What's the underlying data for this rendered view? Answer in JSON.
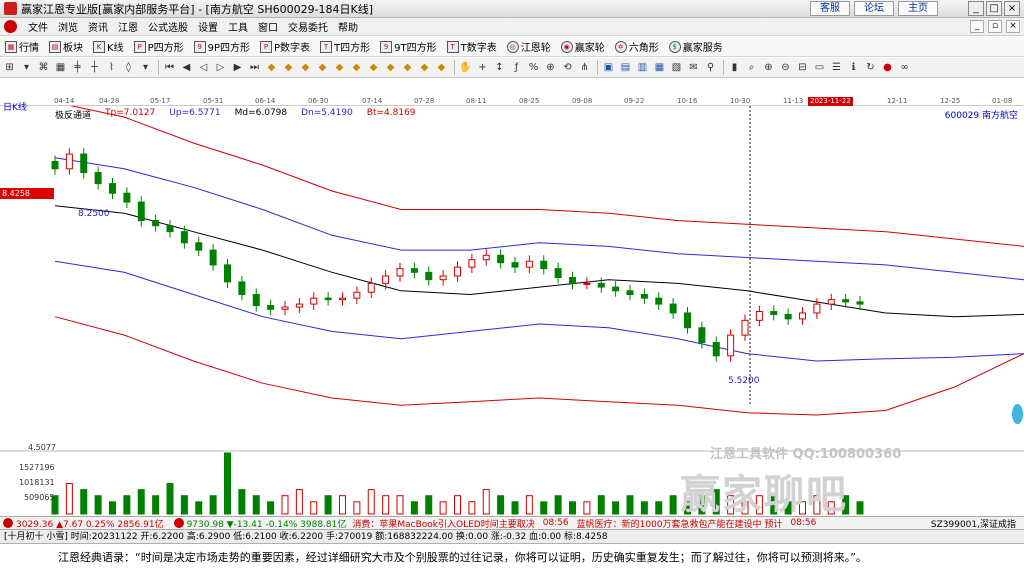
{
  "title_bar": {
    "title": "赢家江恩专业版[赢家内部服务平台] - [南方航空  SH600029-184日K线]",
    "links": [
      "客服",
      "论坛",
      "主页"
    ]
  },
  "menu": {
    "items": [
      "文件",
      "浏览",
      "资讯",
      "江恩",
      "公式选股",
      "设置",
      "工具",
      "窗口",
      "交易委托",
      "帮助"
    ]
  },
  "toolbar1": {
    "items": [
      {
        "label": "行情",
        "icon": "grid-icon"
      },
      {
        "label": "板块",
        "icon": "blocks-icon"
      },
      {
        "label": "K线",
        "icon": "kline-icon"
      },
      {
        "label": "P四方形",
        "icon": "p-square-icon"
      },
      {
        "label": "9P四方形",
        "icon": "9p-square-icon"
      },
      {
        "label": "P数字表",
        "icon": "p-table-icon"
      },
      {
        "label": "T四方形",
        "icon": "t-square-icon"
      },
      {
        "label": "9T四方形",
        "icon": "9t-square-icon"
      },
      {
        "label": "T数字表",
        "icon": "t-table-icon"
      },
      {
        "label": "江恩轮",
        "icon": "gann-wheel-icon"
      },
      {
        "label": "赢家轮",
        "icon": "winner-wheel-icon"
      },
      {
        "label": "六角形",
        "icon": "hexagon-icon"
      },
      {
        "label": "赢家服务",
        "icon": "dollar-icon"
      }
    ]
  },
  "time_axis": {
    "ticks": [
      "04-14",
      "04-28",
      "05-17",
      "05-31",
      "06-14",
      "06-30",
      "07-14",
      "07-28",
      "08-11",
      "08-25",
      "09-08",
      "09-22",
      "10-16",
      "10-30",
      "11-13",
      "12-11",
      "12-25",
      "01-08"
    ],
    "cursor_date": "2023-11-22"
  },
  "indicator": {
    "period": "日K线",
    "name": "极反通道",
    "tp": "Tp=7.0127",
    "up": "Up=6.5771",
    "md": "Md=6.0798",
    "dn": "Dn=5.4190",
    "bt": "Bt=4.8169",
    "stock": "600029  南方航空",
    "price_tag": "8.4258",
    "high_label": "8.2500",
    "low_label": "5.5200",
    "colors": {
      "tp": "#d00000",
      "up": "#2a2ad4",
      "md": "#000000",
      "dn": "#2a2ad4",
      "bt": "#d00000"
    }
  },
  "volume": {
    "labels": [
      "4.5077",
      "1527196",
      "1018131",
      "509065"
    ]
  },
  "watermark": {
    "line1": "江恩工具软件  QQ:100800360",
    "line2": "赢家聊吧"
  },
  "index_bar": {
    "sh": "3029.36 ▲7.67 0.25% 2856.91亿",
    "sz": "9730.98 ▼-13.41 -0.14% 3988.81亿",
    "news1": "消费：苹果MacBook引入OLED时间主要取决",
    "time1": "08:56",
    "news2": "蓝帆医疗：新的1000万套急救包产能在建设中 预计",
    "time2": "08:56",
    "right": "SZ399001,深证成指"
  },
  "status": {
    "text": "[十月初十 小雪] 时间:20231122 开:6.2200 高:6.2900 低:6.2100 收:6.2200 手:270019 额:168832224.00 换:0.00 涨:-0.32 血:0.00 标:8.4258"
  },
  "quote": {
    "text": "江恩经典语录：“时间是决定市场走势的重要因素，经过详细研究大市及个别股票的过往记录，你将可以证明，历史确实重复发生；而了解过往，你将可以预测将来。”。"
  },
  "chart_data": {
    "type": "candlestick",
    "title": "南方航空 600029 日K线",
    "price_series_approx": [
      8.05,
      8.25,
      8.0,
      7.85,
      7.72,
      7.6,
      7.35,
      7.28,
      7.2,
      7.05,
      6.95,
      6.75,
      6.52,
      6.35,
      6.2,
      6.15,
      6.18,
      6.22,
      6.3,
      6.28,
      6.3,
      6.38,
      6.5,
      6.6,
      6.7,
      6.65,
      6.55,
      6.6,
      6.72,
      6.82,
      6.88,
      6.78,
      6.72,
      6.8,
      6.7,
      6.58,
      6.5,
      6.5,
      6.45,
      6.4,
      6.35,
      6.3,
      6.22,
      6.1,
      5.9,
      5.7,
      5.52,
      5.8,
      6.0,
      6.12,
      6.08,
      6.02,
      6.1,
      6.22,
      6.28,
      6.25,
      6.22
    ],
    "volume_approx": [
      0.3,
      0.5,
      0.4,
      0.3,
      0.2,
      0.3,
      0.4,
      0.3,
      0.5,
      0.3,
      0.2,
      0.3,
      1.0,
      0.4,
      0.3,
      0.2,
      0.3,
      0.4,
      0.2,
      0.3,
      0.3,
      0.2,
      0.4,
      0.3,
      0.3,
      0.2,
      0.3,
      0.2,
      0.3,
      0.2,
      0.4,
      0.3,
      0.2,
      0.3,
      0.2,
      0.3,
      0.2,
      0.2,
      0.3,
      0.2,
      0.3,
      0.2,
      0.2,
      0.3,
      0.2,
      0.3,
      0.4,
      0.3,
      0.2,
      0.3,
      0.3,
      0.2,
      0.2,
      0.3,
      0.2,
      0.3,
      0.2
    ],
    "ylim": [
      4.5077,
      8.4258
    ],
    "series": [
      {
        "name": "Tp",
        "last": 7.0127
      },
      {
        "name": "Up",
        "last": 6.5771
      },
      {
        "name": "Md",
        "last": 6.0798
      },
      {
        "name": "Dn",
        "last": 5.419
      },
      {
        "name": "Bt",
        "last": 4.8169
      }
    ],
    "annotations": [
      "8.2500",
      "5.5200"
    ]
  }
}
